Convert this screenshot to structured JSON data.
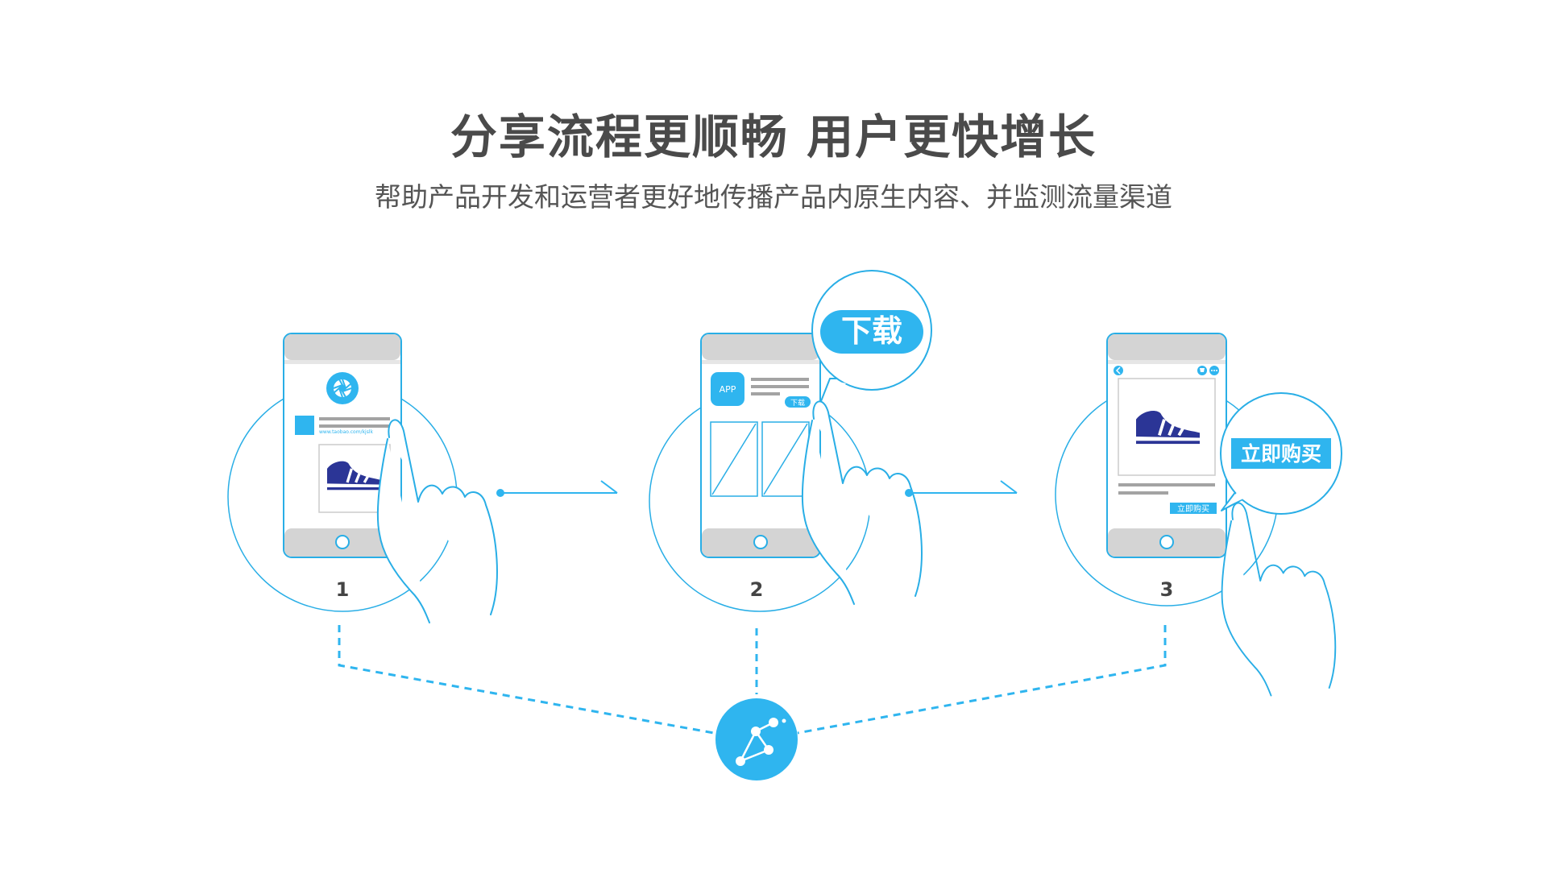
{
  "header": {
    "title": "分享流程更顺畅 用户更快增长",
    "subtitle": "帮助产品开发和运营者更好地传播产品内原生内容、并监测流量渠道"
  },
  "colors": {
    "accent": "#2fb5ef",
    "outline": "#29aee6",
    "shoe": "#2b3596",
    "gray_bar": "#d4d4d4",
    "text_lines": "#a3a3a3",
    "title_text": "#4a4a4a"
  },
  "steps": [
    {
      "number": "1",
      "icons": [
        "aperture-icon",
        "shoe-icon",
        "hand-pointer-icon"
      ],
      "link_text": "www.taobao.com/kjslk"
    },
    {
      "number": "2",
      "icons": [
        "app-icon",
        "hand-pointer-icon"
      ],
      "app_label": "APP",
      "small_button": "下载",
      "bubble": "下载"
    },
    {
      "number": "3",
      "icons": [
        "back-icon",
        "cart-icon",
        "more-icon",
        "shoe-icon",
        "hand-pointer-icon"
      ],
      "small_button": "立即购买",
      "bubble": "立即购买"
    }
  ],
  "hub": {
    "icon": "share-network-icon"
  }
}
